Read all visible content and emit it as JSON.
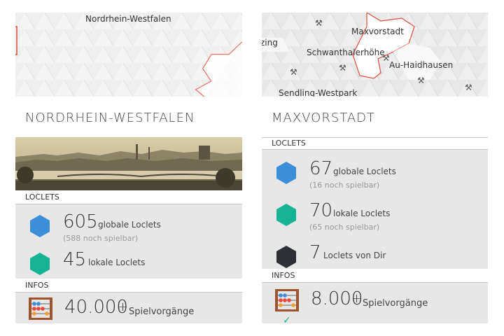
{
  "left": {
    "map": {
      "label": "Nordrhein-Westfalen"
    },
    "title": "NORDRHEIN-WESTFALEN",
    "loclets_section": "LOCLETS",
    "global": {
      "number": "605",
      "label": "globale Loclets",
      "sub": "(588 noch spielbar)"
    },
    "local": {
      "number": "45",
      "label": "lokale Loclets"
    },
    "infos_section": "INFOS",
    "plays": {
      "number": "40.000",
      "suffix": "+",
      "label": "Spielvorgänge"
    }
  },
  "right": {
    "map": {
      "labels": [
        "zing",
        "Maxvorstadt",
        "Schwanthalerhöhe",
        "Au-Haidhausen",
        "Sendling-Westpark"
      ]
    },
    "title": "MAXVORSTADT",
    "loclets_section": "LOCLETS",
    "global": {
      "number": "67",
      "label": "globale Loclets",
      "sub": "(16 noch spielbar)"
    },
    "local": {
      "number": "70",
      "label": "lokale Loclets",
      "sub": "(65 noch spielbar)"
    },
    "own": {
      "number": "7",
      "label": "Loclets von Dir"
    },
    "infos_section": "INFOS",
    "plays": {
      "number": "8.000",
      "suffix": "+",
      "label": "Spielvorgänge"
    }
  },
  "colors": {
    "global": "#3b8fd9",
    "local": "#16b394",
    "own": "#2d3037",
    "border": "#e8493a",
    "stats_bg": "#e7e7e7"
  },
  "icons": [
    "hexagon-blue-icon",
    "hexagon-green-icon",
    "hexagon-dark-icon",
    "abacus-icon",
    "pin-icon",
    "check-icon"
  ]
}
